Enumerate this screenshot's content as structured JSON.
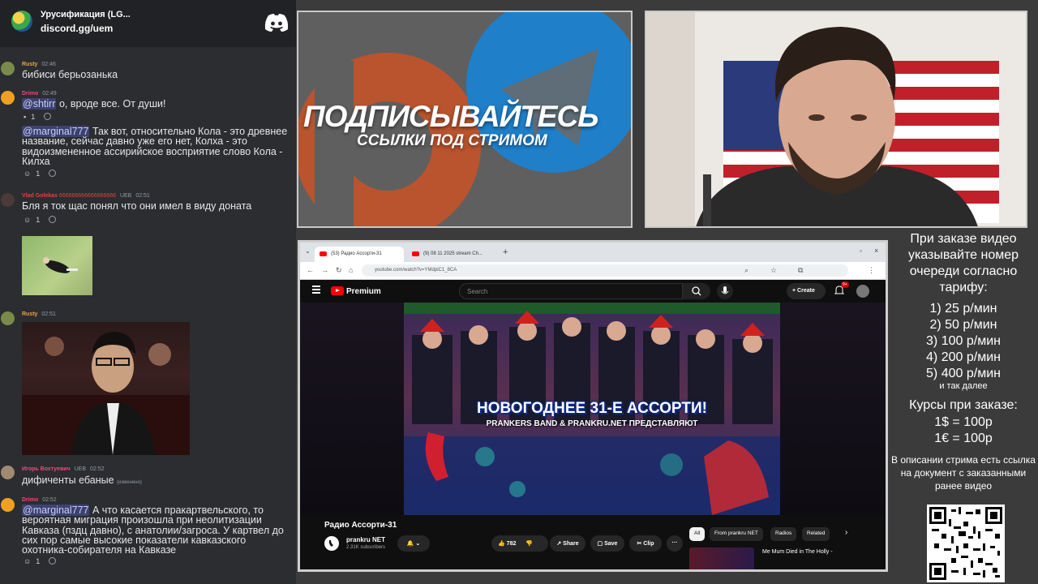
{
  "discord": {
    "server_name": "Урусификация (LG...",
    "invite": "discord.gg/uem",
    "messages": [
      {
        "author": "Rusty",
        "time": "02:46",
        "text": "бибиси берьозанька"
      },
      {
        "author": "Drimo",
        "time": "02:49",
        "mention": "@shtirr",
        "text": " о, вроде все. От души!",
        "reactions": [
          "1"
        ]
      },
      {
        "mention": "@marginal777",
        "text": " Так вот, относительно Кола - это древнее название, сейчас давно уже его нет, Колха - это видоизмененное ассирийское восприятие слово Кола - Килха",
        "reactions": [
          "1"
        ]
      },
      {
        "author": "Vlad Golekas",
        "tag_suffix": "666666666666666666",
        "badge": "UEB",
        "time": "02:51",
        "text": "Бля я ток щас понял что они имел в виду доната",
        "reactions": [
          "1"
        ]
      },
      {
        "author": "Rusty",
        "time": "02:51"
      },
      {
        "author": "Игорь Вохтуевич",
        "badge": "UEB",
        "time": "02:52",
        "text": "дифиченты ебаные",
        "edited": "(изменено)"
      },
      {
        "author": "Drimo",
        "time": "02:52",
        "mention": "@marginal777",
        "text": " А что касается пракартвельского, то вероятная миграция произошла при неолитизации Кавказа (пздц давно), с анатолии/загроса. У картвел до сих пор самые высокие показатели кавказского охотника-собирателя на Кавказе",
        "reactions": [
          "1"
        ]
      }
    ]
  },
  "promo": {
    "heading": "ПОДПИСЫВАЙТЕСЬ",
    "subheading": "ССЫЛКИ ПОД СТРИМОМ"
  },
  "browser": {
    "tab_active": "(53) Радио Ассорти-31",
    "tab_inactive": "(9) 08 11 2025 stream Ch...",
    "url": "youtube.com/watch?v=YMdpiC1_8CA",
    "brand": "Premium",
    "search_placeholder": "Search",
    "create_label": "Create",
    "bell_badge": "9+",
    "thumb_title": "НОВОГОДНЕЕ 31-Е АССОРТИ!",
    "thumb_sub": "PRANKERS BAND & PRANKRU.NET ПРЕДСТАВЛЯЮТ",
    "video_title": "Радио Ассорти-31",
    "channel_name": "prankru NET",
    "channel_subs": "2.31K subscribers",
    "like_count": "782",
    "share_label": "Share",
    "save_label": "Save",
    "clip_label": "Clip",
    "chips": [
      "All",
      "From prankru NET",
      "Radios",
      "Related"
    ],
    "rec_title": "Me Mum Died in The Holly -"
  },
  "info": {
    "order_note": "При заказе видео указывайте номер очереди согласно тарифу:",
    "prices": [
      "1) 25 р/мин",
      "2) 50 р/мин",
      "3) 100 р/мин",
      "4) 200 р/мин",
      "5) 400 р/мин"
    ],
    "more": "и так далее",
    "rates_title": "Курсы при заказе:",
    "rates": [
      "1$ = 100р",
      "1€ = 100р"
    ],
    "desc_note": "В описании стрима есть ссылка на документ с заказанными ранее видео"
  },
  "colors": {
    "discord_bg": "#2b2d31",
    "mention_bg": "#3c4270",
    "rusty": "#e8a440",
    "drimo": "#f0487a",
    "vlad": "#e0443e",
    "igor": "#f0487a",
    "youtube_red": "#ff0000"
  }
}
